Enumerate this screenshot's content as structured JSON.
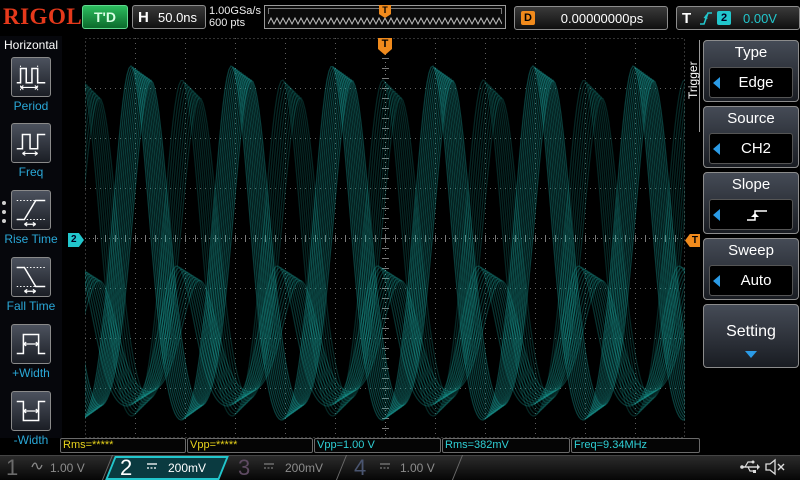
{
  "brand": "RIGOL",
  "run_status": "T'D",
  "timebase": {
    "label": "H",
    "value": "50.0ns"
  },
  "acquisition": {
    "sample_rate": "1.00GSa/s",
    "memory_depth": "600 pts"
  },
  "memory_bar": {
    "trigger_marker": "T"
  },
  "delay": {
    "label": "D",
    "value": "0.00000000ps"
  },
  "trigger_status": {
    "label": "T",
    "slope_icon": "rising-edge-icon",
    "source": "2",
    "level": "0.00V"
  },
  "sidebar": {
    "title": "Horizontal",
    "items": [
      {
        "label": "Period",
        "icon": "period-icon"
      },
      {
        "label": "Freq",
        "icon": "freq-icon"
      },
      {
        "label": "Rise Time",
        "icon": "rise-time-icon"
      },
      {
        "label": "Fall Time",
        "icon": "fall-time-icon"
      },
      {
        "label": "+Width",
        "icon": "positive-width-icon"
      },
      {
        "label": "-Width",
        "icon": "negative-width-icon"
      }
    ]
  },
  "screen": {
    "trigger_position_marker": "T",
    "channel_marker": "2",
    "trigger_level_marker": "T"
  },
  "menu": {
    "title": "Trigger",
    "items": [
      {
        "title": "Type",
        "value": "Edge"
      },
      {
        "title": "Source",
        "value": "CH2"
      },
      {
        "title": "Slope",
        "value_icon": "rising-edge-icon"
      },
      {
        "title": "Sweep",
        "value": "Auto"
      },
      {
        "title": "Setting",
        "more_icon": "down-arrow-icon"
      }
    ]
  },
  "measurements": [
    {
      "text": "Rms=*****",
      "color": "#e8d41c"
    },
    {
      "text": "Vpp=*****",
      "color": "#e8d41c"
    },
    {
      "text": "Vpp=1.00 V",
      "color": "#2fd0d6"
    },
    {
      "text": "Rms=382mV",
      "color": "#2fd0d6"
    },
    {
      "text": "Freq=9.34MHz",
      "color": "#2fd0d6"
    }
  ],
  "channels": [
    {
      "number": "1",
      "coupling_icon": "ac-coupling-icon",
      "scale": "1.00 V",
      "active": false
    },
    {
      "number": "2",
      "coupling_icon": "dc-coupling-icon",
      "scale": "200mV",
      "active": true
    },
    {
      "number": "3",
      "coupling_icon": "dc-coupling-icon",
      "scale": "200mV",
      "active": false
    },
    {
      "number": "4",
      "coupling_icon": "dc-coupling-icon",
      "scale": "1.00 V",
      "active": false
    }
  ],
  "status_icons": [
    "usb-icon",
    "speaker-muted-icon"
  ],
  "colors": {
    "brand": "#e5391b",
    "run_status": "#1f9e4a",
    "ch1": "#e8d41c",
    "ch2": "#22c6cc",
    "ch3": "#c23dc4",
    "ch4": "#3a6ff0",
    "trigger_marker": "#f08a1c",
    "menu_arrow": "#2b9be6",
    "sidebar_label": "#2aa8d8",
    "waveform": "#1fbdb6",
    "inactive_channel": "#6b6b6b"
  }
}
